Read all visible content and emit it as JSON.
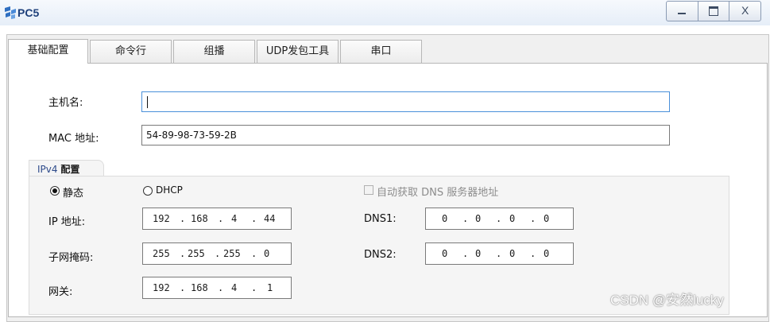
{
  "window": {
    "title": "PC5",
    "close_label": "X"
  },
  "tabs": [
    {
      "label": "基础配置",
      "active": true
    },
    {
      "label": "命令行",
      "active": false
    },
    {
      "label": "组播",
      "active": false
    },
    {
      "label": "UDP发包工具",
      "active": false
    },
    {
      "label": "串口",
      "active": false
    }
  ],
  "basic": {
    "hostname_label": "主机名:",
    "hostname_value": "",
    "mac_label": "MAC 地址:",
    "mac_value": "54-89-98-73-59-2B"
  },
  "ipv4": {
    "group_prefix": "IPv4",
    "group_title": "配置",
    "static_label": "静态",
    "dhcp_label": "DHCP",
    "mode": "static",
    "auto_dns_label": "自动获取 DNS 服务器地址",
    "auto_dns_checked": false,
    "ip_label": "IP 地址:",
    "ip": [
      "192",
      "168",
      "4",
      "44"
    ],
    "mask_label": "子网掩码:",
    "mask": [
      "255",
      "255",
      "255",
      "0"
    ],
    "gateway_label": "网关:",
    "gateway": [
      "192",
      "168",
      "4",
      "1"
    ],
    "dns1_label": "DNS1:",
    "dns1": [
      "0",
      "0",
      "0",
      "0"
    ],
    "dns2_label": "DNS2:",
    "dns2": [
      "0",
      "0",
      "0",
      "0"
    ]
  },
  "watermark": "CSDN @安然lucky",
  "colors": {
    "title_text": "#1d3f7a",
    "focus_border": "#4a90d9",
    "tab_bg": "#ececec"
  }
}
